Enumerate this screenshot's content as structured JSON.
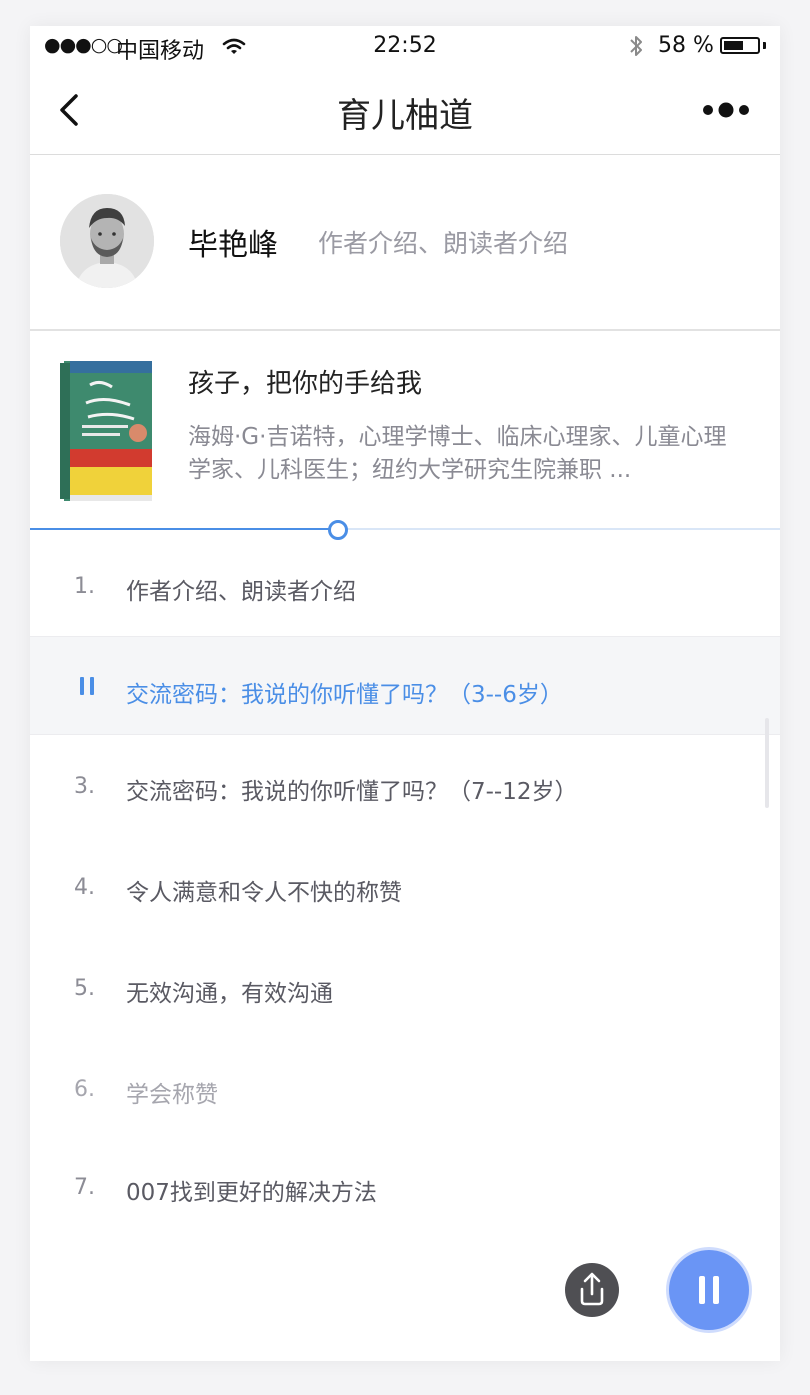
{
  "status_bar": {
    "signal": "●●●○○",
    "carrier": "中国移动",
    "time": "22:52",
    "battery_text": "58 %",
    "battery_level": 0.58
  },
  "nav": {
    "title": "育儿柚道"
  },
  "author": {
    "name": "毕艳峰",
    "subtitle": "作者介绍、朗读者介绍"
  },
  "book": {
    "title": "孩子，把你的手给我",
    "description": "海姆·G·吉诺特，心理学博士、临床心理家、儿童心理学家、儿科医生；纽约大学研究生院兼职 ..."
  },
  "progress": {
    "fraction": 0.41
  },
  "chapters": [
    {
      "number": "1.",
      "label": "作者介绍、朗读者介绍"
    },
    {
      "number": "",
      "label": "交流密码：我说的你听懂了吗？（3--6岁）"
    },
    {
      "number": "3.",
      "label": "交流密码：我说的你听懂了吗？（7--12岁）"
    },
    {
      "number": "4.",
      "label": "令人满意和令人不快的称赞"
    },
    {
      "number": "5.",
      "label": "无效沟通，有效沟通"
    },
    {
      "number": "6.",
      "label": "学会称赞"
    },
    {
      "number": "7.",
      "label": "007找到更好的解决方法"
    }
  ],
  "colors": {
    "accent": "#4a8ee6",
    "play_button": "#6a95f5",
    "share_button": "#4f4f53"
  }
}
